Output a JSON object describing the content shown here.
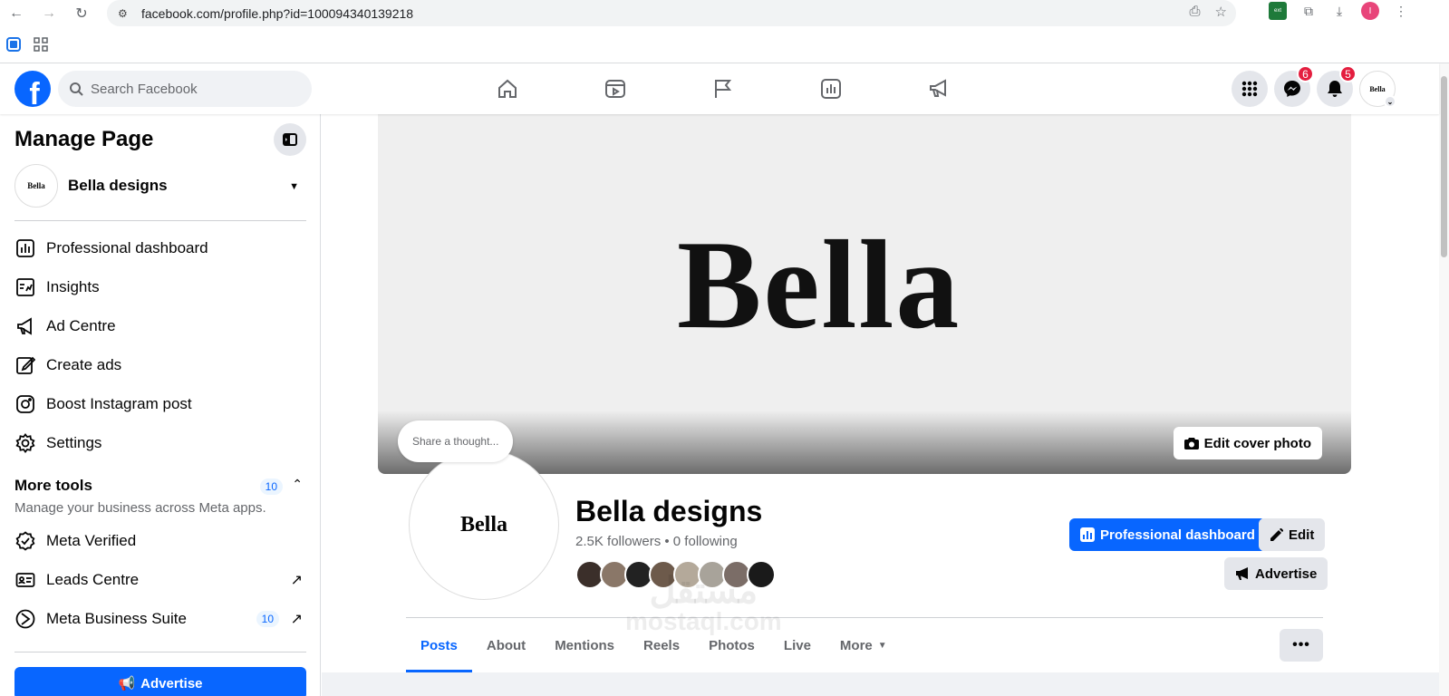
{
  "browser": {
    "url": "facebook.com/profile.php?id=100094340139218",
    "profile_initial": "I"
  },
  "header": {
    "search_placeholder": "Search Facebook",
    "logo_letter": "f",
    "messenger_badge": "6",
    "notifications_badge": "5",
    "avatar_text": "Bella",
    "nav_items": [
      "home-icon",
      "reels-icon",
      "flag-icon",
      "dashboard-icon",
      "megaphone-icon"
    ]
  },
  "sidebar": {
    "title": "Manage Page",
    "page_name": "Bella designs",
    "page_avatar_text": "Bella",
    "items": [
      {
        "label": "Professional dashboard",
        "icon": "dashboard-icon"
      },
      {
        "label": "Insights",
        "icon": "insights-icon"
      },
      {
        "label": "Ad Centre",
        "icon": "megaphone-icon"
      },
      {
        "label": "Create ads",
        "icon": "pencil-icon"
      },
      {
        "label": "Boost Instagram post",
        "icon": "instagram-icon"
      },
      {
        "label": "Settings",
        "icon": "gear-icon"
      }
    ],
    "more_tools": {
      "title": "More tools",
      "subtitle": "Manage your business across Meta apps.",
      "count": "10"
    },
    "tool_items": [
      {
        "label": "Meta Verified",
        "icon": "verified-icon"
      },
      {
        "label": "Leads Centre",
        "icon": "leads-icon"
      },
      {
        "label": "Meta Business Suite",
        "icon": "business-suite-icon",
        "count": "10"
      }
    ],
    "advertise_label": "Advertise"
  },
  "profile": {
    "cover_word": "Bella",
    "edit_cover_label": "Edit cover photo",
    "share_thought": "Share a thought...",
    "profile_pic_text": "Bella",
    "name": "Bella designs",
    "followers_text": "2.5K followers • 0 following",
    "friend_colors": [
      "#3b2f2a",
      "#8a7768",
      "#222",
      "#6d5a4b",
      "#b4a99a",
      "#a8a39a",
      "#7b6d67",
      "#1a1a1a"
    ],
    "buttons": {
      "pro_dashboard": "Professional dashboard",
      "edit": "Edit",
      "advertise": "Advertise"
    }
  },
  "tabs": [
    "Posts",
    "About",
    "Mentions",
    "Reels",
    "Photos",
    "Live",
    "More"
  ],
  "watermark": {
    "arabic": "مستقل",
    "latin": "mostaql.com"
  },
  "colors": {
    "brand": "#0866ff",
    "badge": "#e41e3f"
  }
}
